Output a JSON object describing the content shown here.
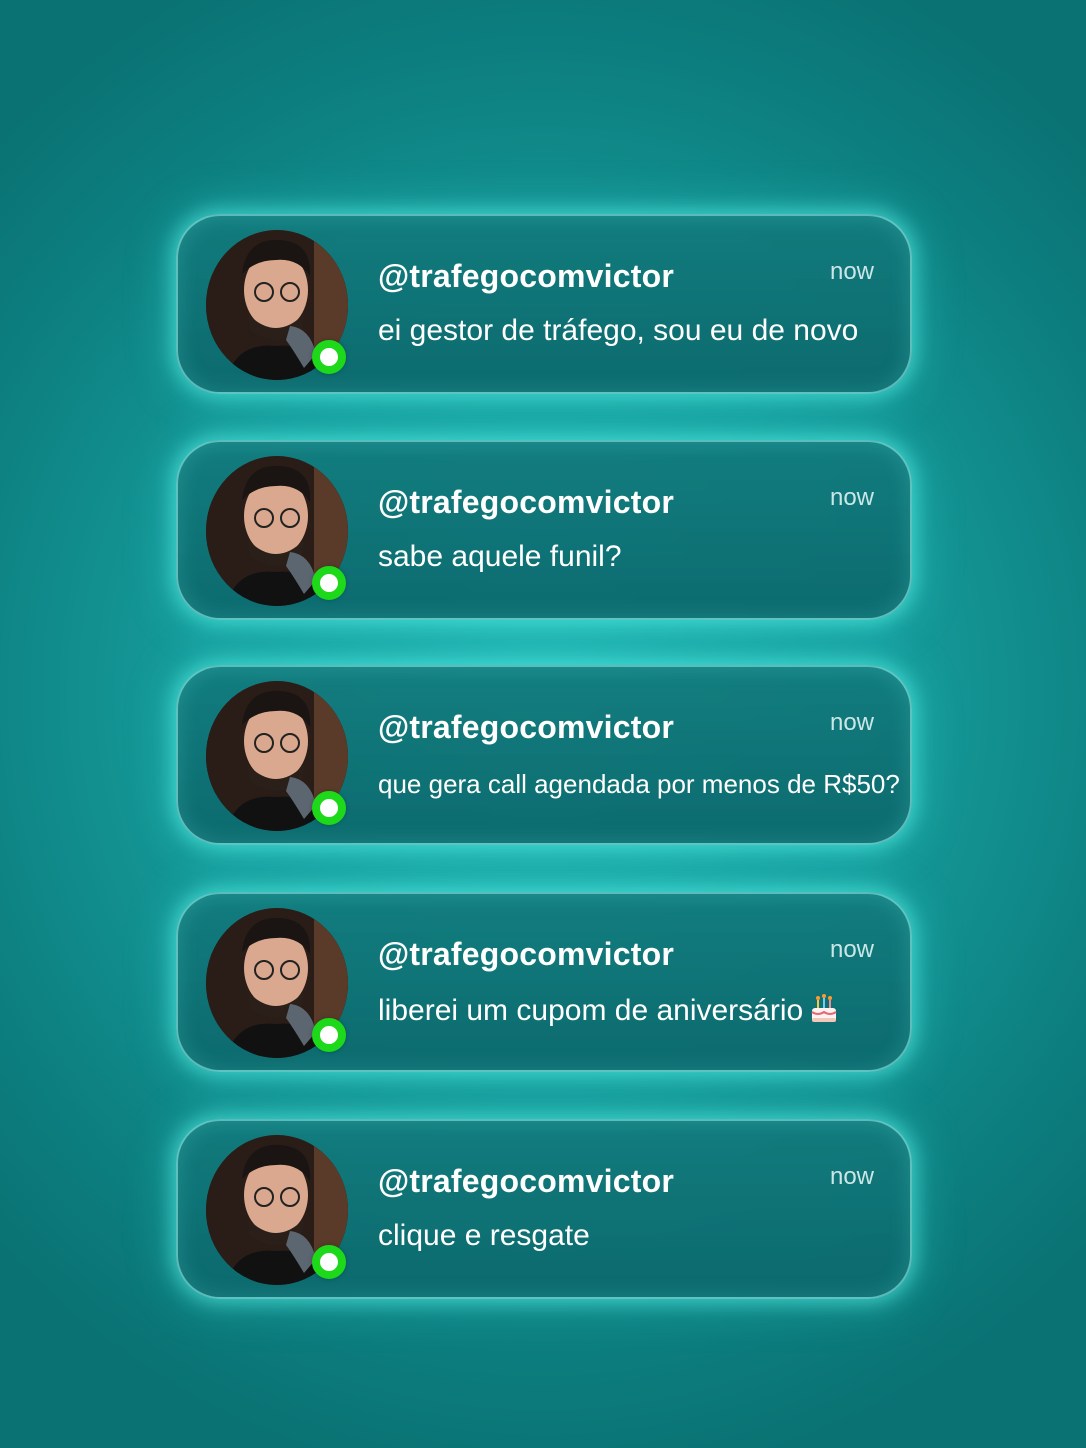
{
  "notifications": [
    {
      "handle": "@trafegocomvictor",
      "time": "now",
      "message": "ei gestor de tráfego, sou eu de novo"
    },
    {
      "handle": "@trafegocomvictor",
      "time": "now",
      "message": "sabe aquele funil?"
    },
    {
      "handle": "@trafegocomvictor",
      "time": "now",
      "message": "que gera call agendada por menos de R$50?"
    },
    {
      "handle": "@trafegocomvictor",
      "time": "now",
      "message": "liberei um cupom de aniversário",
      "emoji": "birthday-cake-icon"
    },
    {
      "handle": "@trafegocomvictor",
      "time": "now",
      "message": "clique e resgate"
    }
  ],
  "colors": {
    "background": "#169c9b",
    "card_glow": "#5af5eb",
    "online_status": "#1ed81a"
  }
}
